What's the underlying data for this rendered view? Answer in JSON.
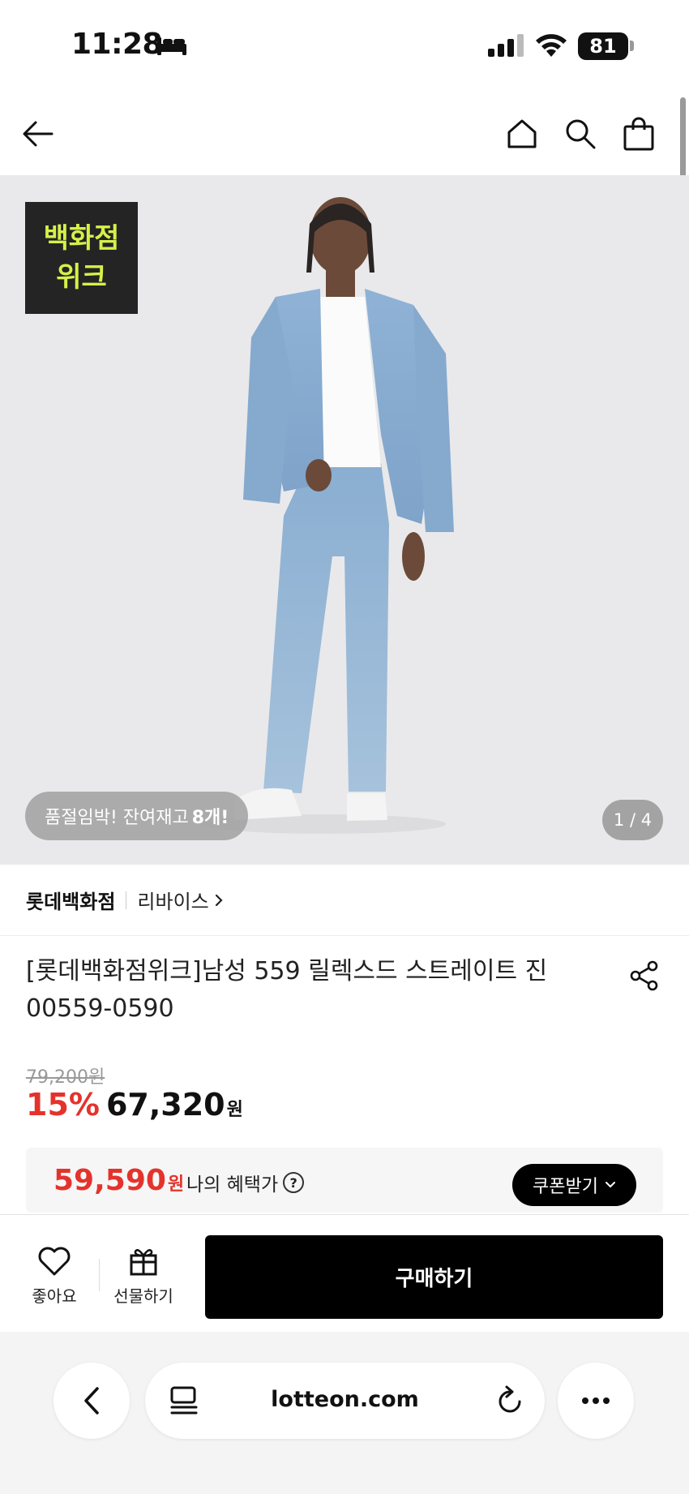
{
  "status_bar": {
    "time": "11:28",
    "battery": "81"
  },
  "header": {
    "icons": [
      "back-arrow-icon",
      "home-icon",
      "search-icon",
      "shopping-bag-icon"
    ]
  },
  "hero": {
    "promo_badge_line1": "백화점",
    "promo_badge_line2": "위크",
    "promo_badge_color": "#d6f04a",
    "stock_text": "품절임박! 잔여재고",
    "stock_count": "8개!",
    "page_indicator": "1 / 4",
    "image_description": "model-in-denim-jacket-and-jeans"
  },
  "store": {
    "name": "롯데백화점",
    "brand": "리바이스"
  },
  "product": {
    "title_line1": "[롯데백화점위크]남성 559 릴렉스드 스트레이트 진",
    "title_line2": "00559-0590"
  },
  "price": {
    "original": "79,200원",
    "discount": "15%",
    "sale": "67,320",
    "currency": "원"
  },
  "benefit": {
    "price": "59,590",
    "currency": "원",
    "label": "나의 혜택가",
    "help": "?",
    "coupon_button": "쿠폰받기",
    "accent_color": "#e4332c"
  },
  "actions": {
    "like_label": "좋아요",
    "gift_label": "선물하기",
    "buy_label": "구매하기"
  },
  "browser": {
    "url": "lotteon.com"
  }
}
